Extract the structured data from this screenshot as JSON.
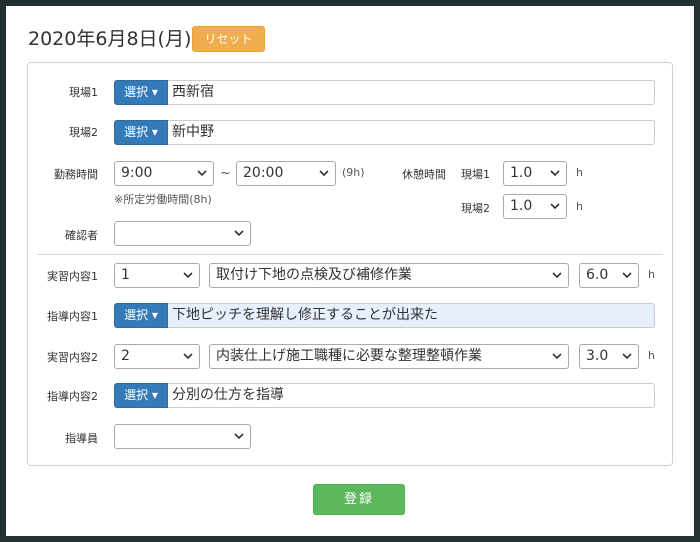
{
  "header": {
    "date": "2020年6月8日(月)",
    "reset_label": "リセット"
  },
  "form": {
    "site1": {
      "label": "現場1",
      "button": "選択",
      "value": "西新宿"
    },
    "site2": {
      "label": "現場2",
      "button": "選択",
      "value": "新中野"
    },
    "work_hours": {
      "label": "勤務時間",
      "start": "9:00",
      "tilde": "~",
      "end": "20:00",
      "total": "(9h)",
      "note": "※所定労働時間(8h)"
    },
    "break": {
      "label": "休憩時間",
      "site1_label": "現場1",
      "site1_value": "1.0",
      "site2_label": "現場2",
      "site2_value": "1.0",
      "unit": "h"
    },
    "confirmer": {
      "label": "確認者",
      "value": ""
    },
    "practice1": {
      "label": "実習内容1",
      "number": "1",
      "task": "取付け下地の点検及び補修作業",
      "hours": "6.0",
      "unit": "h"
    },
    "guidance1": {
      "label": "指導内容1",
      "button": "選択",
      "value": "下地ピッチを理解し修正することが出来た"
    },
    "practice2": {
      "label": "実習内容2",
      "number": "2",
      "task": "内装仕上げ施工職種に必要な整理整頓作業",
      "hours": "3.0",
      "unit": "h"
    },
    "guidance2": {
      "label": "指導内容2",
      "button": "選択",
      "value": "分別の仕方を指導"
    },
    "instructor": {
      "label": "指導員",
      "value": ""
    }
  },
  "submit_label": "登録"
}
